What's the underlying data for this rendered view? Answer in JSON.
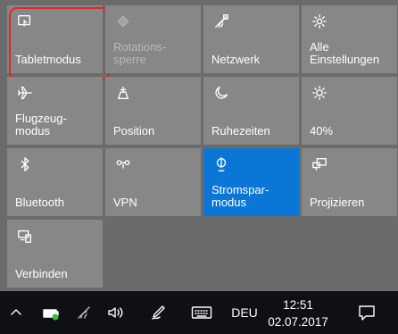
{
  "tiles": [
    {
      "label": "Tabletmodus",
      "icon": "tablet-mode-icon",
      "state": "highlighted"
    },
    {
      "label": "Rotations-\nsperre",
      "icon": "rotation-lock-icon",
      "state": "disabled"
    },
    {
      "label": "Netzwerk",
      "icon": "network-icon",
      "state": "normal"
    },
    {
      "label": "Alle\nEinstellungen",
      "icon": "gear-icon",
      "state": "normal"
    },
    {
      "label": "Flugzeug-\nmodus",
      "icon": "airplane-icon",
      "state": "normal"
    },
    {
      "label": "Position",
      "icon": "location-icon",
      "state": "normal"
    },
    {
      "label": "Ruhezeiten",
      "icon": "moon-icon",
      "state": "normal"
    },
    {
      "label": "40%",
      "icon": "brightness-icon",
      "state": "normal"
    },
    {
      "label": "Bluetooth",
      "icon": "bluetooth-icon",
      "state": "normal"
    },
    {
      "label": "VPN",
      "icon": "vpn-icon",
      "state": "normal"
    },
    {
      "label": "Stromspar-\nmodus",
      "icon": "battery-saver-icon",
      "state": "active"
    },
    {
      "label": "Projizieren",
      "icon": "project-icon",
      "state": "normal"
    },
    {
      "label": "Verbinden",
      "icon": "connect-icon",
      "state": "normal"
    }
  ],
  "colors": {
    "panel": "#6b6b6b",
    "tile": "#878787",
    "active_tile": "#0a77d6",
    "highlight_border": "#e0262c",
    "taskbar": "#0f0f16"
  },
  "taskbar": {
    "show_hidden_icons": "chevron-up-icon",
    "battery": "battery-charging-icon",
    "wifi": "wifi-icon",
    "volume": "volume-icon",
    "pen": "pen-icon",
    "keyboard": "keyboard-icon",
    "language": "DEU",
    "time": "12:51",
    "date": "02.07.2017",
    "notifications": "notification-icon"
  }
}
